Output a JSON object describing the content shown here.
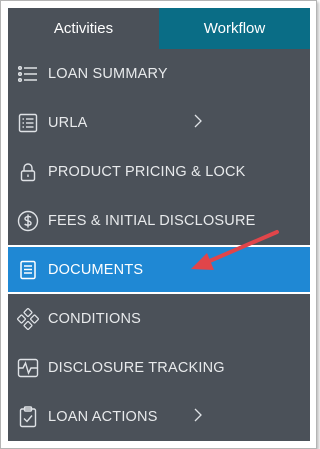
{
  "tabs": [
    {
      "label": "Activities"
    },
    {
      "label": "Workflow"
    }
  ],
  "menu": {
    "items": [
      {
        "label": "LOAN SUMMARY",
        "icon": "list-icon"
      },
      {
        "label": "URLA",
        "icon": "form-icon",
        "has_chevron": true
      },
      {
        "label": "PRODUCT PRICING & LOCK",
        "icon": "lock-icon"
      },
      {
        "label": "FEES & INITIAL DISCLOSURE",
        "icon": "dollar-icon"
      },
      {
        "label": "DOCUMENTS",
        "icon": "document-icon",
        "active": true
      },
      {
        "label": "CONDITIONS",
        "icon": "conditions-icon"
      },
      {
        "label": "DISCLOSURE TRACKING",
        "icon": "tracking-icon"
      },
      {
        "label": "LOAN ACTIONS",
        "icon": "clipboard-check-icon",
        "has_chevron": true
      }
    ]
  },
  "colors": {
    "panel_bg": "#4b5159",
    "workflow_tab": "#0a6d86",
    "active_item": "#1f88d4",
    "annotation_arrow": "#e0454a"
  }
}
